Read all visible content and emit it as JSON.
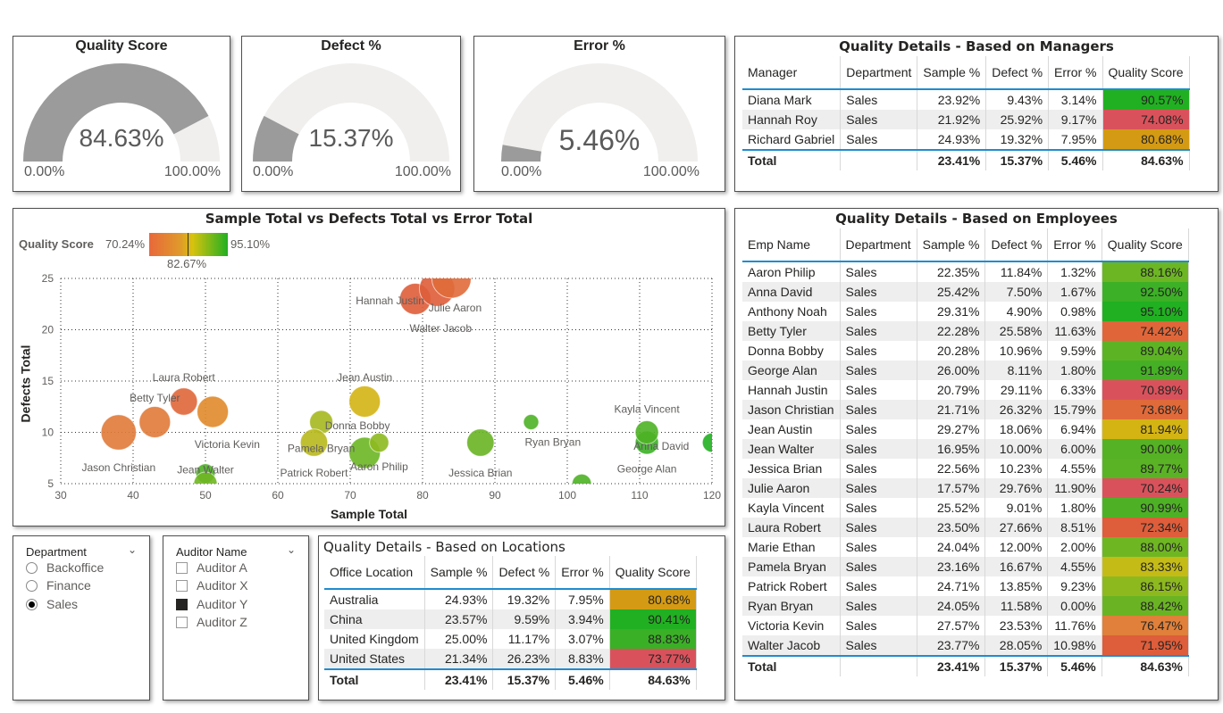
{
  "gauges": [
    {
      "title": "Quality Score",
      "value_label": "84.63%",
      "value": 84.63,
      "min": "0.00%",
      "max": "100.00%"
    },
    {
      "title": "Defect %",
      "value_label": "15.37%",
      "value": 15.37,
      "min": "0.00%",
      "max": "100.00%"
    },
    {
      "title": "Error %",
      "value_label": "5.46%",
      "value": 5.46,
      "min": "0.00%",
      "max": "100.00%"
    }
  ],
  "managers": {
    "title": "Quality Details - Based on Managers",
    "headers": [
      "Manager",
      "Department",
      "Sample %",
      "Defect %",
      "Error %",
      "Quality Score"
    ],
    "rows": [
      [
        "Diana Mark",
        "Sales",
        "23.92%",
        "9.43%",
        "3.14%",
        "90.57%"
      ],
      [
        "Hannah Roy",
        "Sales",
        "21.92%",
        "25.92%",
        "9.17%",
        "74.08%"
      ],
      [
        "Richard Gabriel",
        "Sales",
        "24.93%",
        "19.32%",
        "7.95%",
        "80.68%"
      ]
    ],
    "row_colors": [
      "#21b021",
      "#d9525b",
      "#d49a13"
    ],
    "total": [
      "Total",
      "",
      "23.41%",
      "15.37%",
      "5.46%",
      "84.63%"
    ]
  },
  "scatter": {
    "title": "Sample Total vs Defects Total vs Error Total",
    "legend_label": "Quality Score",
    "legend_min": "70.24%",
    "legend_mid": "82.67%",
    "legend_max": "95.10%",
    "xlabel": "Sample Total",
    "ylabel": "Defects Total"
  },
  "chart_data": {
    "type": "scatter",
    "title": "Sample Total vs Defects Total vs Error Total",
    "xlabel": "Sample Total",
    "ylabel": "Defects Total",
    "xlim": [
      30,
      120
    ],
    "ylim": [
      5,
      25
    ],
    "xticks": [
      30,
      40,
      50,
      60,
      70,
      80,
      90,
      100,
      110,
      120
    ],
    "yticks": [
      5,
      10,
      15,
      20,
      25
    ],
    "points": [
      {
        "label": "Aaron Philip",
        "x": 72,
        "y": 8,
        "size": 3,
        "color": "#6cb623"
      },
      {
        "label": "Anna David",
        "x": 111,
        "y": 9,
        "size": 2,
        "color": "#3cb026"
      },
      {
        "label": "Anthony Noah",
        "x": 120,
        "y": 9,
        "size": 1.5,
        "color": "#21b021"
      },
      {
        "label": "Betty Tyler",
        "x": 43,
        "y": 11,
        "size": 3,
        "color": "#e07a3a"
      },
      {
        "label": "Donna Bobby",
        "x": 66,
        "y": 11,
        "size": 2,
        "color": "#a6b81f"
      },
      {
        "label": "George Alan",
        "x": 111,
        "y": 10,
        "size": 2,
        "color": "#4eb125"
      },
      {
        "label": "Hannah Justin",
        "x": 79,
        "y": 23,
        "size": 3,
        "color": "#de5d3a"
      },
      {
        "label": "Jason Christian",
        "x": 38,
        "y": 10,
        "size": 3.5,
        "color": "#e07a3a"
      },
      {
        "label": "Jean Austin",
        "x": 72,
        "y": 13,
        "size": 3,
        "color": "#d4b413"
      },
      {
        "label": "Jean Walter",
        "x": 50,
        "y": 6,
        "size": 1.5,
        "color": "#4eb125"
      },
      {
        "label": "Jessica Brian",
        "x": 88,
        "y": 9,
        "size": 2.5,
        "color": "#68b423"
      },
      {
        "label": "Julie Aaron",
        "x": 82,
        "y": 24,
        "size": 3.5,
        "color": "#de5d3a"
      },
      {
        "label": "Kayla Vincent",
        "x": 95,
        "y": 11,
        "size": 1,
        "color": "#4eb125"
      },
      {
        "label": "Laura Robert",
        "x": 47,
        "y": 13,
        "size": 2.5,
        "color": "#e0663a"
      },
      {
        "label": "Victoria Kevin",
        "x": 51,
        "y": 12,
        "size": 3,
        "color": "#e08a2a"
      },
      {
        "label": "Pamela Bryan",
        "x": 65,
        "y": 9,
        "size": 2.5,
        "color": "#b8b81c"
      },
      {
        "label": "Patrick Robert",
        "x": 74,
        "y": 9,
        "size": 1.5,
        "color": "#8db91f"
      },
      {
        "label": "Ryan Bryan",
        "x": 102,
        "y": 5,
        "size": 1.5,
        "color": "#4eb125"
      },
      {
        "label": "Walter Jacob",
        "x": 84,
        "y": 25,
        "size": 4,
        "color": "#e06a3a"
      },
      {
        "label": "Marie Ethan",
        "x": 50,
        "y": 5,
        "size": 2,
        "color": "#70b623"
      }
    ],
    "text_labels": [
      {
        "text": "Hannah Justin",
        "x": 75.5,
        "y": 22.5
      },
      {
        "text": "Julie Aaron",
        "x": 84.5,
        "y": 21.8
      },
      {
        "text": "Walter Jacob",
        "x": 82.5,
        "y": 19.8
      },
      {
        "text": "Laura Robert",
        "x": 47,
        "y": 15
      },
      {
        "text": "Jean Austin",
        "x": 72,
        "y": 15
      },
      {
        "text": "Betty Tyler",
        "x": 43,
        "y": 13
      },
      {
        "text": "Donna Bobby",
        "x": 71,
        "y": 10.3
      },
      {
        "text": "Kayla Vincent",
        "x": 111,
        "y": 11.9
      },
      {
        "text": "Victoria Kevin",
        "x": 53,
        "y": 8.5
      },
      {
        "text": "Pamela Bryan",
        "x": 66,
        "y": 8.1
      },
      {
        "text": "Ryan Bryan",
        "x": 98,
        "y": 8.7
      },
      {
        "text": "Anna David",
        "x": 113,
        "y": 8.3
      },
      {
        "text": "Aaron Philip",
        "x": 74,
        "y": 6.3
      },
      {
        "text": "Jason Christian",
        "x": 38,
        "y": 6.2
      },
      {
        "text": "Jean Walter",
        "x": 50,
        "y": 6.0
      },
      {
        "text": "Jessica Brian",
        "x": 88,
        "y": 5.7
      },
      {
        "text": "George Alan",
        "x": 111,
        "y": 6.1
      },
      {
        "text": "Patrick Robert",
        "x": 65,
        "y": 5.7
      }
    ]
  },
  "slicer_department": {
    "title": "Department",
    "options": [
      {
        "label": "Backoffice",
        "selected": false
      },
      {
        "label": "Finance",
        "selected": false
      },
      {
        "label": "Sales",
        "selected": true
      }
    ]
  },
  "slicer_auditor": {
    "title": "Auditor Name",
    "options": [
      {
        "label": "Auditor A",
        "selected": false
      },
      {
        "label": "Auditor X",
        "selected": false
      },
      {
        "label": "Auditor Y",
        "selected": true
      },
      {
        "label": "Auditor Z",
        "selected": false
      }
    ]
  },
  "locations": {
    "title": "Quality Details - Based on Locations",
    "headers": [
      "Office Location",
      "Sample %",
      "Defect %",
      "Error %",
      "Quality Score"
    ],
    "rows": [
      [
        "Australia",
        "24.93%",
        "19.32%",
        "7.95%",
        "80.68%"
      ],
      [
        "China",
        "23.57%",
        "9.59%",
        "3.94%",
        "90.41%"
      ],
      [
        "United Kingdom",
        "25.00%",
        "11.17%",
        "3.07%",
        "88.83%"
      ],
      [
        "United States",
        "21.34%",
        "26.23%",
        "8.83%",
        "73.77%"
      ]
    ],
    "row_colors": [
      "#d49a13",
      "#21b021",
      "#3ab026",
      "#d9525b"
    ],
    "total": [
      "Total",
      "23.41%",
      "15.37%",
      "5.46%",
      "84.63%"
    ]
  },
  "employees": {
    "title": "Quality Details - Based on Employees",
    "headers": [
      "Emp Name",
      "Department",
      "Sample %",
      "Defect %",
      "Error %",
      "Quality Score"
    ],
    "rows": [
      [
        "Aaron Philip",
        "Sales",
        "22.35%",
        "11.84%",
        "1.32%",
        "88.16%"
      ],
      [
        "Anna David",
        "Sales",
        "25.42%",
        "7.50%",
        "1.67%",
        "92.50%"
      ],
      [
        "Anthony Noah",
        "Sales",
        "29.31%",
        "4.90%",
        "0.98%",
        "95.10%"
      ],
      [
        "Betty Tyler",
        "Sales",
        "22.28%",
        "25.58%",
        "11.63%",
        "74.42%"
      ],
      [
        "Donna Bobby",
        "Sales",
        "20.28%",
        "10.96%",
        "9.59%",
        "89.04%"
      ],
      [
        "George Alan",
        "Sales",
        "26.00%",
        "8.11%",
        "1.80%",
        "91.89%"
      ],
      [
        "Hannah Justin",
        "Sales",
        "20.79%",
        "29.11%",
        "6.33%",
        "70.89%"
      ],
      [
        "Jason Christian",
        "Sales",
        "21.71%",
        "26.32%",
        "15.79%",
        "73.68%"
      ],
      [
        "Jean Austin",
        "Sales",
        "29.27%",
        "18.06%",
        "6.94%",
        "81.94%"
      ],
      [
        "Jean Walter",
        "Sales",
        "16.95%",
        "10.00%",
        "6.00%",
        "90.00%"
      ],
      [
        "Jessica Brian",
        "Sales",
        "22.56%",
        "10.23%",
        "4.55%",
        "89.77%"
      ],
      [
        "Julie Aaron",
        "Sales",
        "17.57%",
        "29.76%",
        "11.90%",
        "70.24%"
      ],
      [
        "Kayla Vincent",
        "Sales",
        "25.52%",
        "9.01%",
        "1.80%",
        "90.99%"
      ],
      [
        "Laura Robert",
        "Sales",
        "23.50%",
        "27.66%",
        "8.51%",
        "72.34%"
      ],
      [
        "Marie Ethan",
        "Sales",
        "24.04%",
        "12.00%",
        "2.00%",
        "88.00%"
      ],
      [
        "Pamela Bryan",
        "Sales",
        "23.16%",
        "16.67%",
        "4.55%",
        "83.33%"
      ],
      [
        "Patrick Robert",
        "Sales",
        "24.71%",
        "13.85%",
        "9.23%",
        "86.15%"
      ],
      [
        "Ryan Bryan",
        "Sales",
        "24.05%",
        "11.58%",
        "0.00%",
        "88.42%"
      ],
      [
        "Victoria Kevin",
        "Sales",
        "27.57%",
        "23.53%",
        "11.76%",
        "76.47%"
      ],
      [
        "Walter Jacob",
        "Sales",
        "23.77%",
        "28.05%",
        "10.98%",
        "71.95%"
      ]
    ],
    "row_colors": [
      "#6cb623",
      "#3cb026",
      "#21b021",
      "#e0663a",
      "#5cb424",
      "#45b025",
      "#d9525b",
      "#e06a3a",
      "#d4b413",
      "#55b224",
      "#5ab324",
      "#d9525b",
      "#4eb125",
      "#de5d3a",
      "#6fb623",
      "#c4bb16",
      "#8db91f",
      "#6ab423",
      "#e0803a",
      "#de5d3a"
    ],
    "total": [
      "Total",
      "",
      "23.41%",
      "15.37%",
      "5.46%",
      "84.63%"
    ]
  }
}
